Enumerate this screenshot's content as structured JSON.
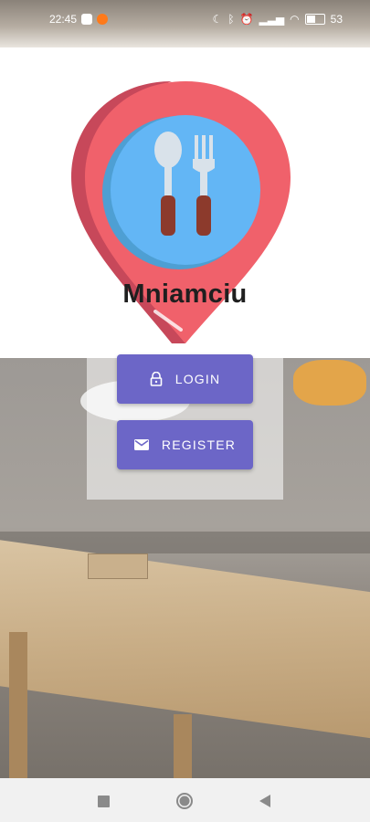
{
  "status_bar": {
    "time": "22:45",
    "battery_text": "53",
    "battery_level": 0.53
  },
  "app": {
    "title": "Mniamciu"
  },
  "buttons": {
    "login_label": "LOGIN",
    "register_label": "REGISTER"
  },
  "icons": {
    "login": "lock-icon",
    "register": "mail-icon",
    "logo": "restaurant-location-pin-icon",
    "nav_recent": "square-recent-icon",
    "nav_home": "circle-home-icon",
    "nav_back": "triangle-back-icon"
  },
  "colors": {
    "button": "#6c66c7",
    "pin_red": "#f0616b",
    "pin_blue": "#63b6f5"
  }
}
